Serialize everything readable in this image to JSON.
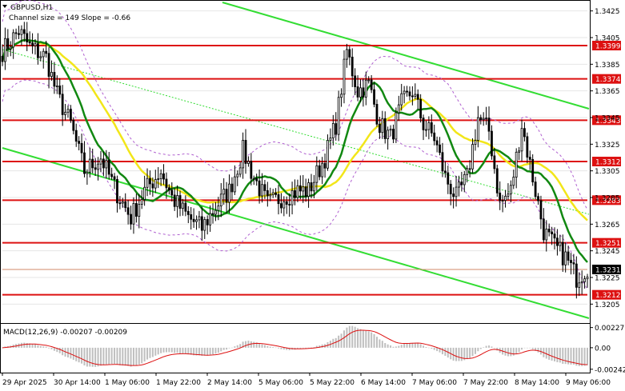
{
  "chart_data": [
    {
      "type": "candlestick",
      "title": "GBPUSD,H1",
      "subtitle": "Channel size = 149 Slope = -0.66",
      "yticks": [
        "1.3425",
        "1.3405",
        "1.3385",
        "1.3365",
        "1.3345",
        "1.3325",
        "1.3305",
        "1.3285",
        "1.3265",
        "1.3245",
        "1.3225",
        "1.3205"
      ],
      "ylim": [
        1.3192,
        1.3432
      ],
      "xticks": [
        "29 Apr 2025",
        "30 Apr 14:00",
        "1 May 06:00",
        "1 May 22:00",
        "2 May 14:00",
        "5 May 06:00",
        "5 May 22:00",
        "6 May 14:00",
        "7 May 06:00",
        "7 May 22:00",
        "8 May 14:00",
        "9 May 06:00"
      ],
      "last_price": "1.3231",
      "levels": [
        {
          "label": "1.3399",
          "value": 1.3399
        },
        {
          "label": "1.3374",
          "value": 1.3374
        },
        {
          "label": "1.3343",
          "value": 1.3343
        },
        {
          "label": "1.3312",
          "value": 1.3312
        },
        {
          "label": "1.3283",
          "value": 1.3283
        },
        {
          "label": "1.3251",
          "value": 1.3251
        },
        {
          "label": "1.3212",
          "value": 1.3212
        }
      ],
      "anchors": [
        [
          0,
          1.3395
        ],
        [
          6,
          1.341
        ],
        [
          10,
          1.3398
        ],
        [
          16,
          1.339
        ],
        [
          20,
          1.3362
        ],
        [
          25,
          1.334
        ],
        [
          30,
          1.3305
        ],
        [
          36,
          1.3315
        ],
        [
          42,
          1.3288
        ],
        [
          47,
          1.327
        ],
        [
          52,
          1.329
        ],
        [
          58,
          1.3305
        ],
        [
          62,
          1.3285
        ],
        [
          68,
          1.327
        ],
        [
          73,
          1.3262
        ],
        [
          78,
          1.3278
        ],
        [
          83,
          1.329
        ],
        [
          88,
          1.332
        ],
        [
          92,
          1.33
        ],
        [
          97,
          1.328
        ],
        [
          102,
          1.3285
        ],
        [
          108,
          1.329
        ],
        [
          112,
          1.329
        ],
        [
          118,
          1.3315
        ],
        [
          122,
          1.334
        ],
        [
          126,
          1.3395
        ],
        [
          130,
          1.3365
        ],
        [
          134,
          1.337
        ],
        [
          138,
          1.334
        ],
        [
          142,
          1.333
        ],
        [
          146,
          1.3355
        ],
        [
          150,
          1.3365
        ],
        [
          154,
          1.334
        ],
        [
          158,
          1.333
        ],
        [
          162,
          1.33
        ],
        [
          166,
          1.3285
        ],
        [
          170,
          1.33
        ],
        [
          174,
          1.3345
        ],
        [
          178,
          1.3335
        ],
        [
          182,
          1.328
        ],
        [
          186,
          1.329
        ],
        [
          190,
          1.334
        ],
        [
          194,
          1.33
        ],
        [
          198,
          1.326
        ],
        [
          202,
          1.3248
        ],
        [
          206,
          1.324
        ],
        [
          210,
          1.3225
        ],
        [
          214,
          1.3232
        ]
      ]
    },
    {
      "type": "macd",
      "title": "MACD(12,26,9) -0.00207 -0.00209",
      "yticks": [
        "0.00227",
        "0.00",
        "-0.00242"
      ],
      "ylim": [
        -0.0028,
        0.0026
      ]
    }
  ]
}
